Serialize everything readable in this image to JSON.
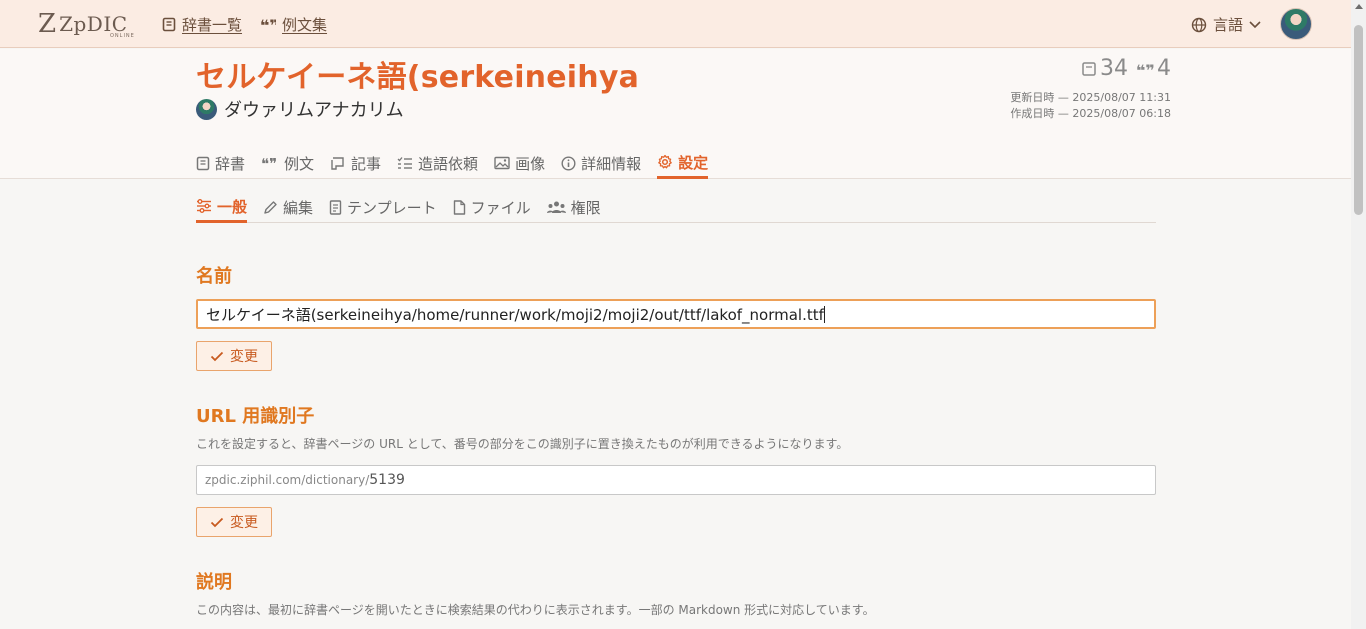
{
  "brand": {
    "logo_text": "ZpDIC",
    "logo_sub": "ONLINE"
  },
  "topnav": {
    "dictionaries": "辞書一覧",
    "examples": "例文集"
  },
  "language": {
    "label": "言語"
  },
  "dictionary": {
    "title": "セルケイーネ語(serkeineihya",
    "owner": "ダウァリムアナカリム",
    "word_count": "34",
    "example_count": "4",
    "updated": "更新日時 — 2025/08/07 11:31",
    "created": "作成日時 — 2025/08/07 06:18"
  },
  "main_tabs": [
    {
      "label": "辞書",
      "icon": "book-icon"
    },
    {
      "label": "例文",
      "icon": "quote-icon"
    },
    {
      "label": "記事",
      "icon": "scroll-icon"
    },
    {
      "label": "造語依頼",
      "icon": "list-check-icon"
    },
    {
      "label": "画像",
      "icon": "image-icon"
    },
    {
      "label": "詳細情報",
      "icon": "info-icon"
    },
    {
      "label": "設定",
      "icon": "gear-icon",
      "active": true
    }
  ],
  "sub_tabs": [
    {
      "label": "一般",
      "icon": "sliders-icon",
      "active": true
    },
    {
      "label": "編集",
      "icon": "pencil-icon"
    },
    {
      "label": "テンプレート",
      "icon": "document-icon"
    },
    {
      "label": "ファイル",
      "icon": "file-icon"
    },
    {
      "label": "権限",
      "icon": "users-icon"
    }
  ],
  "name_section": {
    "title": "名前",
    "value": "セルケイーネ語(serkeineihya/home/runner/work/moji2/moji2/out/ttf/lakof_normal.ttf",
    "button": "変更"
  },
  "url_section": {
    "title": "URL 用識別子",
    "description": "これを設定すると、辞書ページの URL として、番号の部分をこの識別子に置き換えたものが利用できるようになります。",
    "prefix": "zpdic.ziphil.com/dictionary/",
    "placeholder": "5139",
    "button": "変更"
  },
  "description_section": {
    "title": "説明",
    "description": "この内容は、最初に辞書ページを開いたときに検索結果の代わりに表示されます。一部の Markdown 形式に対応しています。"
  },
  "colors": {
    "accent": "#e2632b",
    "section": "#e07820",
    "topbar": "#fbece3"
  }
}
